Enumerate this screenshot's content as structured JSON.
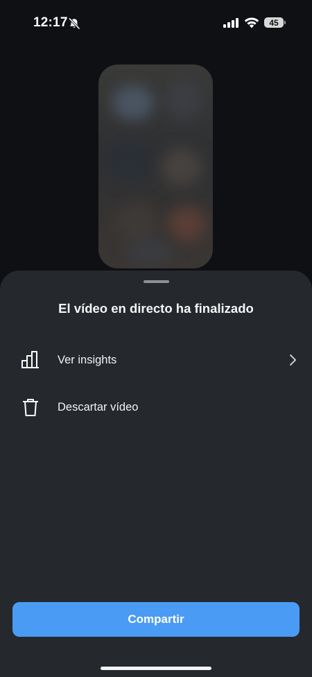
{
  "status_bar": {
    "time": "12:17",
    "battery_level": "45",
    "icons": [
      "bell-slash-icon",
      "cellular-signal-icon",
      "wifi-icon",
      "battery-icon"
    ]
  },
  "preview": {
    "state": "blurred-thumbnail"
  },
  "sheet": {
    "title": "El vídeo en directo ha finalizado",
    "items": [
      {
        "label": "Ver insights",
        "icon": "bar-chart-icon",
        "has_chevron": true
      },
      {
        "label": "Descartar vídeo",
        "icon": "trash-icon",
        "has_chevron": false
      }
    ],
    "primary_button": "Compartir"
  },
  "colors": {
    "background": "#0e1014",
    "sheet": "#25282d",
    "button": "#4a9bf3",
    "text": "#ffffff"
  }
}
